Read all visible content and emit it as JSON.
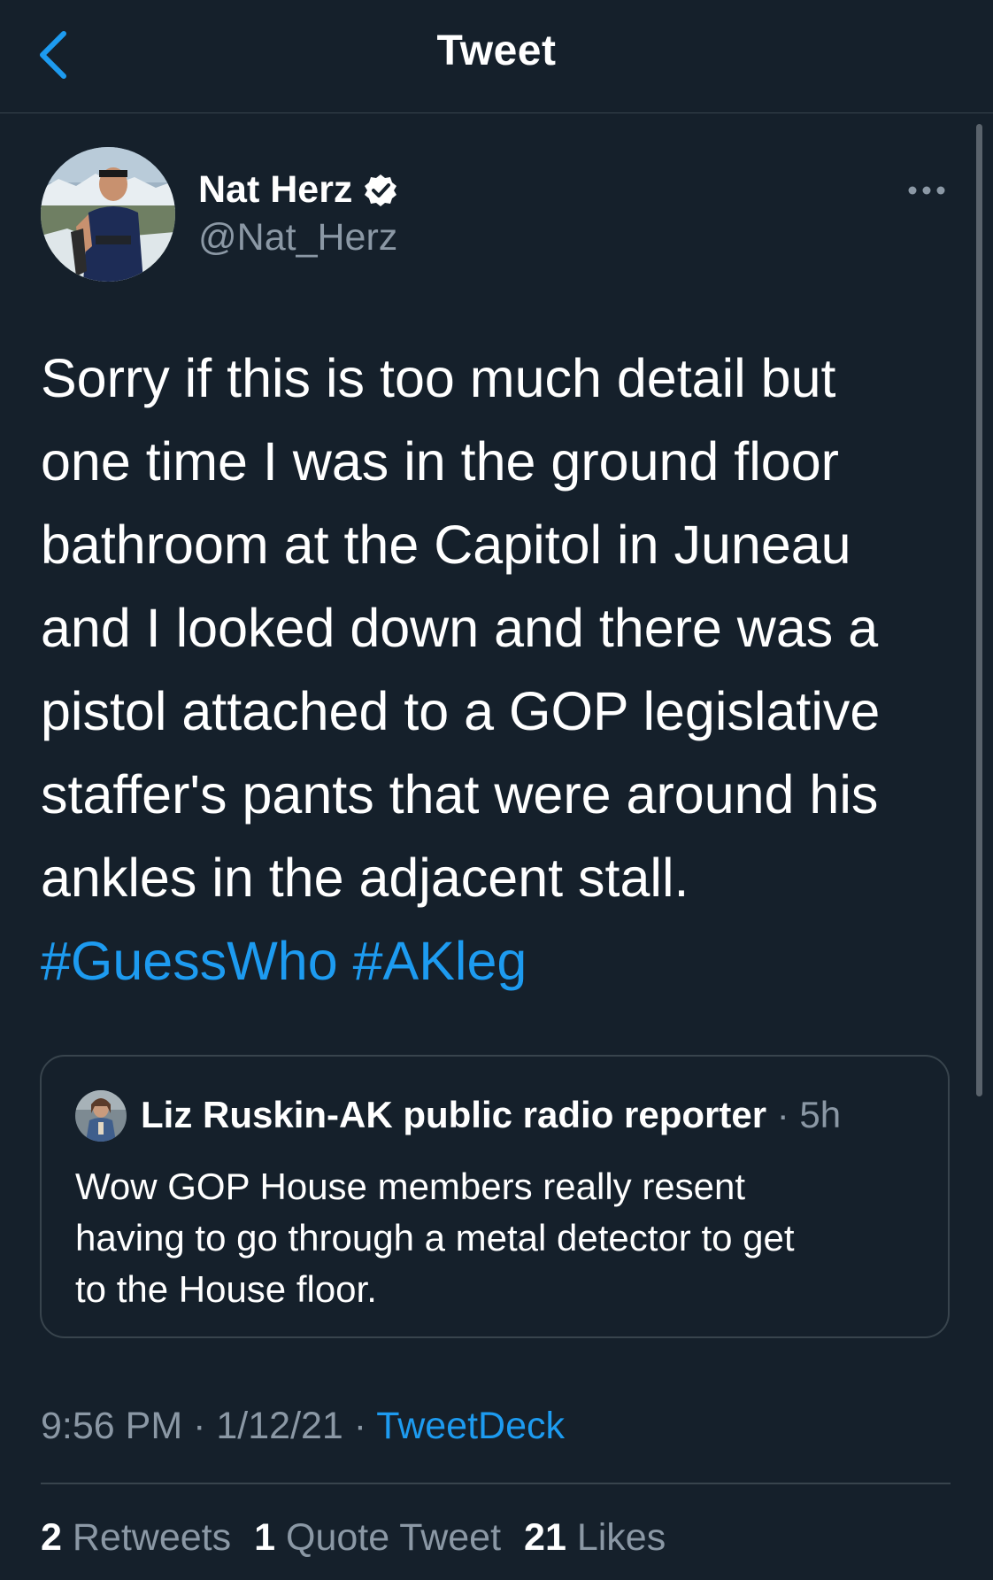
{
  "header": {
    "title": "Tweet",
    "back_icon": "chevron-left-icon"
  },
  "colors": {
    "background": "#15202b",
    "accent": "#1d9bf0",
    "muted_text": "#8b98a5",
    "border": "#38444d"
  },
  "tweet": {
    "author_name": "Nat Herz",
    "author_handle": "@Nat_Herz",
    "verified_icon": "verified-badge-icon",
    "more_icon": "more-horizontal-icon",
    "text_lines": [
      "Sorry if this is too much detail but",
      "one time I was in the ground floor",
      "bathroom at the Capitol in Juneau",
      "and I looked down and there was a",
      "pistol attached to a GOP legislative",
      "staffer's pants that were around his",
      "ankles in the adjacent stall."
    ],
    "hashtags": [
      "#GuessWho",
      "#AKleg"
    ],
    "time": "9:56 PM",
    "date": "1/12/21",
    "source": "TweetDeck",
    "separator": "·"
  },
  "quoted_tweet": {
    "author_name": "Liz Ruskin-AK public radio reporter",
    "time": "5h",
    "separator": "·",
    "text_lines": [
      "Wow GOP House members really resent",
      "having to go through a metal detector to get",
      "to the House floor."
    ]
  },
  "stats": {
    "retweets_count": "2",
    "retweets_label": "Retweets",
    "quotes_count": "1",
    "quotes_label": "Quote Tweet",
    "likes_count": "21",
    "likes_label": "Likes"
  }
}
